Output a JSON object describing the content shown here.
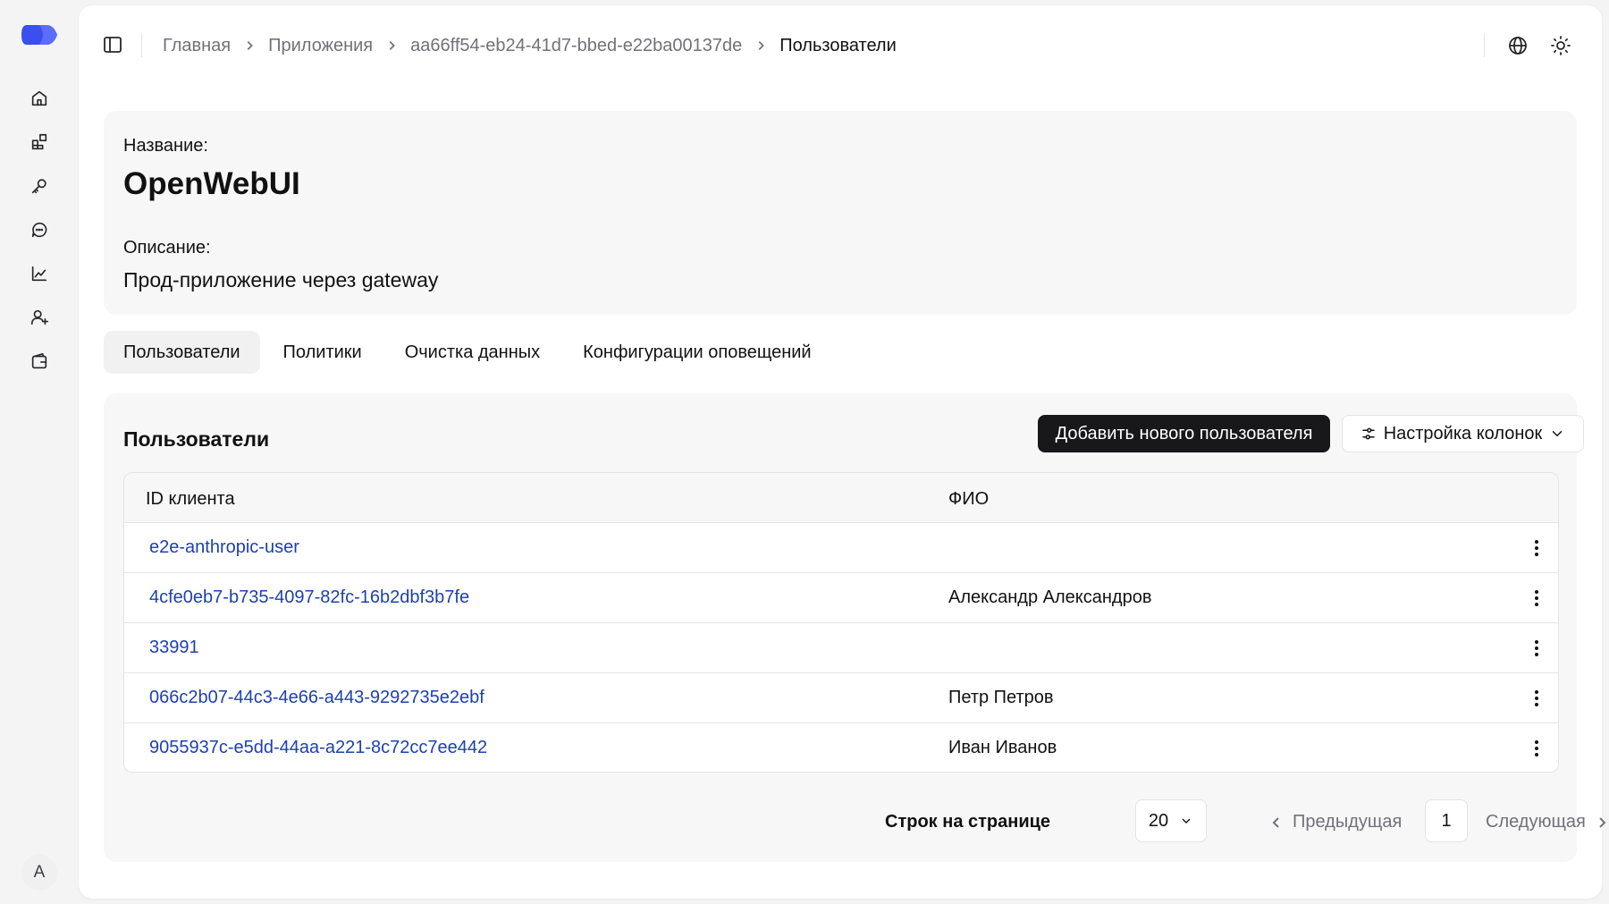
{
  "colors": {
    "brand": "#3b4ef0",
    "link": "#1e40af",
    "primary_button": "#18181b"
  },
  "sidebar": {
    "items": [
      {
        "icon": "home-icon"
      },
      {
        "icon": "apps-icon"
      },
      {
        "icon": "key-icon"
      },
      {
        "icon": "chat-icon"
      },
      {
        "icon": "chart-icon"
      },
      {
        "icon": "user-plus-icon"
      },
      {
        "icon": "wallet-icon"
      }
    ],
    "avatar_initial": "A"
  },
  "header": {
    "breadcrumb": [
      "Главная",
      "Приложения",
      "aa66ff54-eb24-41d7-bbed-e22ba00137de",
      "Пользователи"
    ],
    "icons": [
      "globe-icon",
      "sun-icon"
    ]
  },
  "info": {
    "name_label": "Название:",
    "name": "OpenWebUI",
    "description_label": "Описание:",
    "description": "Прод-приложение через gateway"
  },
  "tabs": [
    {
      "label": "Пользователи",
      "active": true
    },
    {
      "label": "Политики",
      "active": false
    },
    {
      "label": "Очистка данных",
      "active": false
    },
    {
      "label": "Конфигурации оповещений",
      "active": false
    }
  ],
  "users": {
    "title": "Пользователи",
    "add_button": "Добавить нового пользователя",
    "columns_button": "Настройка колонок",
    "columns": [
      "ID клиента",
      "ФИО"
    ],
    "rows": [
      {
        "id": "e2e-anthropic-user",
        "name": ""
      },
      {
        "id": "4cfe0eb7-b735-4097-82fc-16b2dbf3b7fe",
        "name": "Александр Александров"
      },
      {
        "id": "33991",
        "name": ""
      },
      {
        "id": "066c2b07-44c3-4e66-a443-9292735e2ebf",
        "name": "Петр Петров"
      },
      {
        "id": "9055937c-e5dd-44aa-a221-8c72cc7ee442",
        "name": "Иван Иванов"
      }
    ]
  },
  "pagination": {
    "rows_label": "Строк на странице",
    "rows_value": "20",
    "prev": "Предыдущая",
    "current": "1",
    "next": "Следующая"
  }
}
